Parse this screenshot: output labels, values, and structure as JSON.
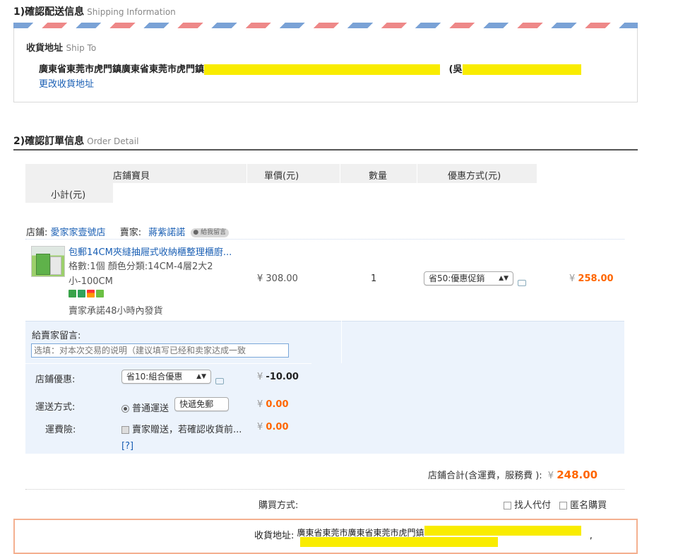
{
  "shipping": {
    "title": "1)確認配送信息",
    "title_en": "Shipping Information",
    "ship_to_label": "收貨地址",
    "ship_to_label_en": "Ship To",
    "address_text": "廣東省東莞市虎門鎮廣東省東莞市虎門鎮",
    "recipient_prefix": "(吳",
    "change_link": "更改收貨地址"
  },
  "order": {
    "title": "2)確認訂單信息",
    "title_en": "Order Detail",
    "columns": {
      "item": "店鋪寶貝",
      "unit_price": "單價(元)",
      "quantity": "數量",
      "discount": "優惠方式(元)",
      "subtotal": "小計(元)"
    },
    "store_label": "店鋪:",
    "store_name": "愛家家壹號店",
    "seller_label": "賣家:",
    "seller_name": "蔣紫諾諾",
    "message_seller_btn": "給我留言",
    "item": {
      "title": "包郵14CM夾縫抽屜式收納櫃整理櫃廚...",
      "spec_line1": "格數:1個  顏色分類:14CM-4層2大2",
      "spec_line2": "小-100CM",
      "promise": "賣家承諾48小時內發貨",
      "unit_price": "¥ 308.00",
      "quantity": "1",
      "discount_option": "省50:優惠促銷",
      "subtotal_symbol": "¥",
      "subtotal": "258.00"
    },
    "memo_label": "給賣家留言:",
    "memo_placeholder": "选填：对本次交易的说明（建议填写已经和卖家达成一致",
    "store_discount_label": "店鋪優惠:",
    "store_discount_option": "省10:組合優惠",
    "store_discount_amount_symbol": "¥",
    "store_discount_amount": "-10.00",
    "shipping_method_label": "運送方式:",
    "shipping_method_value": "普通運送",
    "shipping_method_option": "快遞免郵",
    "shipping_amount_symbol": "¥",
    "shipping_amount": "0.00",
    "insurance_label": "運費險:",
    "insurance_text": "賣家贈送，若確認收貨前...",
    "insurance_help": "[?]",
    "insurance_amount_symbol": "¥",
    "insurance_amount": "0.00",
    "store_total_label": "店鋪合計(含運費，服務費 ):",
    "store_total_symbol": "¥",
    "store_total": "248.00",
    "purchase_method_label": "購買方式:",
    "purchase_options": [
      "找人代付",
      "匿名購買"
    ],
    "final_address_label": "收貨地址:",
    "final_address_text": "廣東省東莞市廣東省東莞市虎門鎮",
    "final_address_comma": ","
  },
  "colors": {
    "accent_orange": "#ff6600",
    "link_blue": "#1a5fb4",
    "redaction_yellow": "#f9ec00",
    "light_blue_bg": "#ecf3fc"
  }
}
